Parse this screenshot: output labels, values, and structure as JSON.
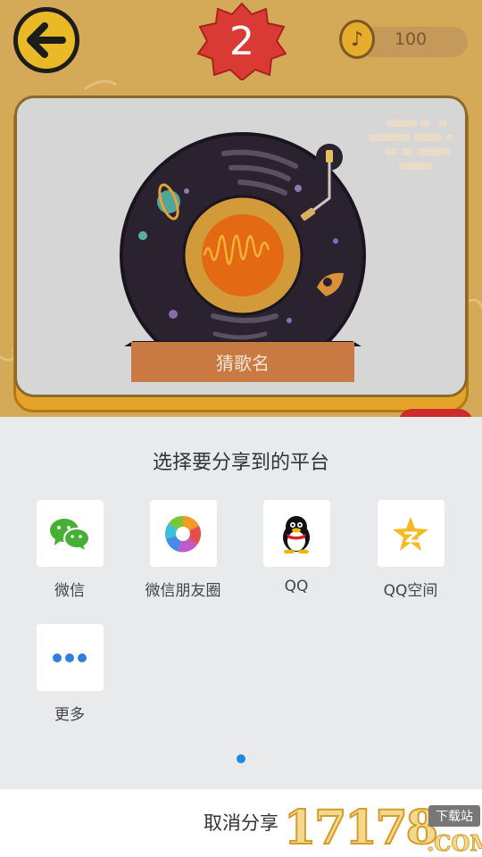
{
  "game": {
    "level": "2",
    "coins": "100",
    "guess_label": "猜歌名"
  },
  "share": {
    "title": "选择要分享到的平台",
    "items": [
      {
        "label": "微信",
        "icon": "wechat-icon"
      },
      {
        "label": "微信朋友圈",
        "icon": "moments-icon"
      },
      {
        "label": "QQ",
        "icon": "qq-penguin-icon"
      },
      {
        "label": "QQ空间",
        "icon": "qzone-star-icon"
      },
      {
        "label": "更多",
        "icon": "more-dots-icon"
      }
    ],
    "page_indicator": {
      "pages": 1,
      "current": 1
    }
  },
  "cancel": {
    "label": "取消分享"
  },
  "watermark": {
    "number": "17178",
    "tag": "下载站",
    "suffix": ".COM"
  },
  "colors": {
    "game_background": "#d4aa58",
    "card_border": "#e5a429",
    "level_badge": "#d93a34",
    "guess_bar": "#c87a42",
    "share_panel": "#e9eaec",
    "indicator": "#1c8ae0"
  }
}
